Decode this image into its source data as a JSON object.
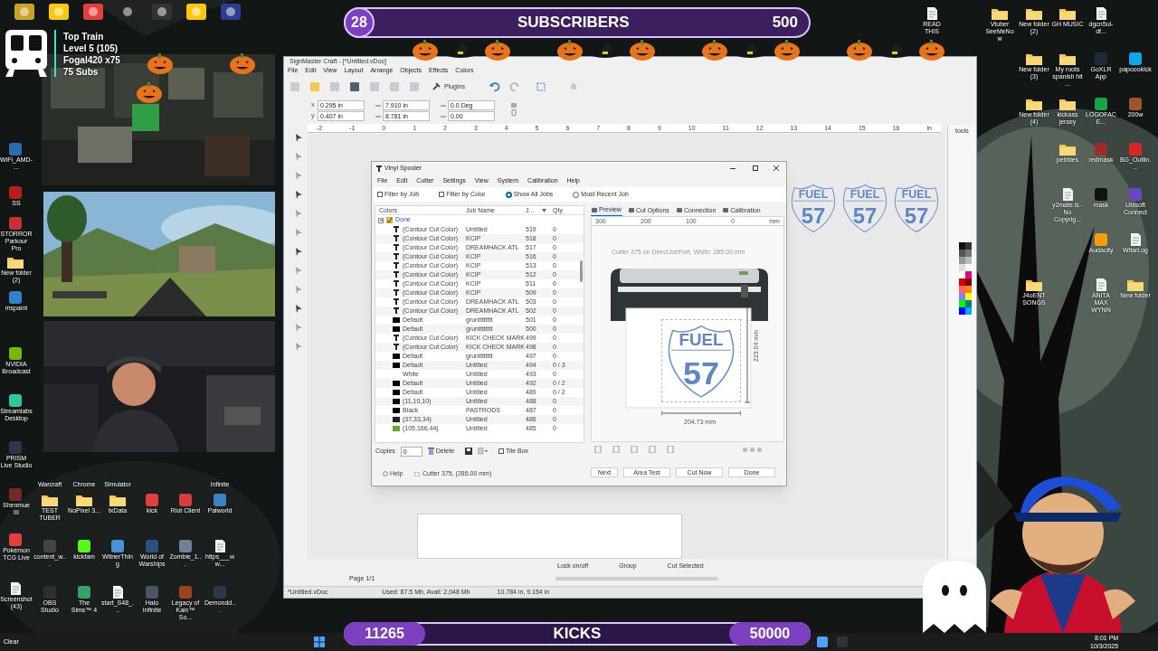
{
  "stream_overlay": {
    "subscribers": {
      "count": "28",
      "label": "SUBSCRIBERS",
      "goal": "500"
    },
    "top_train": {
      "title": "Top Train",
      "level": "Level 5  (105)",
      "leader": "Fogal420 x75",
      "subs": "75 Subs"
    },
    "kicks": {
      "count": "11265",
      "label": "KICKS",
      "goal": "50000"
    }
  },
  "desktop_left": [
    {
      "label": "WiFi_AMD-...",
      "kind": "app",
      "color": "#2b6cb0"
    },
    {
      "label": "SS",
      "kind": "app",
      "color": "#b91c1c"
    },
    {
      "label": "STORROR Parkour Pro",
      "kind": "app",
      "color": "#c53030"
    },
    {
      "label": "New folder (2)",
      "kind": "folder"
    },
    {
      "label": "mspaint",
      "kind": "app",
      "color": "#3182ce"
    },
    {
      "label": "NVIDIA Broadcast",
      "kind": "app",
      "color": "#76b900"
    },
    {
      "label": "Streamlabs Desktop",
      "kind": "app",
      "color": "#31c3a2"
    },
    {
      "label": "PRISM Live Studio",
      "kind": "app",
      "color": "#2d3748"
    },
    {
      "label": "Shenmue III",
      "kind": "app",
      "color": "#742a2a"
    },
    {
      "label": "Pokémon TCG Live",
      "kind": "app",
      "color": "#e53e3e"
    },
    {
      "label": "Screenshot (43)",
      "kind": "file"
    },
    {
      "label": "Warcraft",
      "kind": "covered"
    },
    {
      "label": "Chrome",
      "kind": "covered"
    },
    {
      "label": "Simulator",
      "kind": "covered"
    },
    {
      "label": "Infinite",
      "kind": "covered"
    },
    {
      "label": "TEST TUBER",
      "kind": "folder"
    },
    {
      "label": "NoPixel 3...",
      "kind": "folder"
    },
    {
      "label": "txData",
      "kind": "folder"
    },
    {
      "label": "kick",
      "kind": "app",
      "color": "#e53e3e"
    },
    {
      "label": "Riot Client",
      "kind": "app",
      "color": "#d53f3f"
    },
    {
      "label": "Palworld",
      "kind": "app",
      "color": "#3b82c4"
    },
    {
      "label": "content_w...",
      "kind": "app",
      "color": "#444444"
    },
    {
      "label": "kickfam",
      "kind": "app",
      "color": "#53fc18"
    },
    {
      "label": "WitnerThing",
      "kind": "app",
      "color": "#4a90d9"
    },
    {
      "label": "World of Warships",
      "kind": "app",
      "color": "#2c5282"
    },
    {
      "label": "Zombie_1...",
      "kind": "app",
      "color": "#718096"
    },
    {
      "label": "https___ww...",
      "kind": "file"
    },
    {
      "label": "OBS Studio",
      "kind": "app",
      "color": "#302e31"
    },
    {
      "label": "The Sims™ 4",
      "kind": "app",
      "color": "#38a169"
    },
    {
      "label": "start_S48_...",
      "kind": "file"
    },
    {
      "label": "Halo Infinite",
      "kind": "app",
      "color": "#4a5568"
    },
    {
      "label": "Legacy of Kain™ So...",
      "kind": "app",
      "color": "#9c4221"
    },
    {
      "label": "Demondd...",
      "kind": "app",
      "color": "#2d3748"
    }
  ],
  "desktop_right": [
    {
      "label": "READ THIS",
      "kind": "file"
    },
    {
      "label": "Vtuber SeeMeNow",
      "kind": "folder"
    },
    {
      "label": "New folder (2)",
      "kind": "folder"
    },
    {
      "label": "GH MUSIC",
      "kind": "folder"
    },
    {
      "label": "dgcn5ui-df...",
      "kind": "file"
    },
    {
      "label": "New folder (3)",
      "kind": "folder"
    },
    {
      "label": "My roots spanish hit ...",
      "kind": "folder"
    },
    {
      "label": "GoXLR App",
      "kind": "app",
      "color": "#1f2937"
    },
    {
      "label": "papoookick",
      "kind": "app",
      "color": "#0ea5e9"
    },
    {
      "label": "New folder (4)",
      "kind": "folder"
    },
    {
      "label": "kickass jersey",
      "kind": "folder"
    },
    {
      "label": "LOGOFACE...",
      "kind": "app",
      "color": "#16a34a"
    },
    {
      "label": "200w",
      "kind": "app",
      "color": "#a0522d"
    },
    {
      "label": "pebbles",
      "kind": "folder"
    },
    {
      "label": "redmask",
      "kind": "app",
      "color": "#9b2c2c"
    },
    {
      "label": "BG_Outlin...",
      "kind": "app",
      "color": "#dc2626"
    },
    {
      "label": "y2mate.is - No Copyrig...",
      "kind": "file"
    },
    {
      "label": "mask",
      "kind": "app",
      "color": "#111111"
    },
    {
      "label": "Ubisoft Connect",
      "kind": "app",
      "color": "#6b46c1"
    },
    {
      "label": "Audacity",
      "kind": "app",
      "color": "#f59e0b"
    },
    {
      "label": "WitarLog",
      "kind": "file"
    },
    {
      "label": "J4oENT SONGS",
      "kind": "folder"
    },
    {
      "label": "ANITA MAX WYNN",
      "kind": "file"
    },
    {
      "label": "New folder",
      "kind": "folder"
    }
  ],
  "signmaster": {
    "title": "SignMaster Craft - [*Untitled.vDoc]",
    "menu": [
      "File",
      "Edit",
      "View",
      "Layout",
      "Arrange",
      "Objects",
      "Effects",
      "Colors"
    ],
    "plugins": "Plugins",
    "fields": [
      {
        "label": "x",
        "value": "0.295 in"
      },
      {
        "label": "y",
        "value": "0.407 in"
      },
      {
        "value": "7.910 in"
      },
      {
        "value": "8.781 in"
      },
      {
        "value": "0.0 Deg"
      },
      {
        "value": "0.00"
      }
    ],
    "ruler": [
      "-2",
      "-1",
      "0",
      "1",
      "2",
      "3",
      "4",
      "5",
      "6",
      "7",
      "8",
      "9",
      "10",
      "11",
      "12",
      "13",
      "14",
      "15",
      "16",
      "in"
    ],
    "tools_label": "tools",
    "designs": [
      {
        "top": "FUEL",
        "number": "57"
      },
      {
        "top": "FUEL",
        "number": "57"
      },
      {
        "top": "FUEL",
        "number": "57"
      }
    ],
    "bottom_buttons": [
      "Lock on/off",
      "Group",
      "Cut Selected"
    ],
    "page": "Page 1/1",
    "status": [
      "*Untitled.vDoc",
      "Used: 87.5 Mb, Avail: 2,048 Mb",
      "10.784 in, 9.154 in"
    ]
  },
  "vinyl_spooler": {
    "title": "Vinyl Spooler",
    "menu": [
      "File",
      "Edit",
      "Cutter",
      "Settings",
      "View",
      "System",
      "Calibration",
      "Help"
    ],
    "filters": [
      {
        "kind": "checkbox",
        "label": "Filter by Job",
        "checked": false
      },
      {
        "kind": "checkbox",
        "label": "Filter by Color",
        "checked": false
      },
      {
        "kind": "radio",
        "label": "Show All Jobs",
        "selected": true
      },
      {
        "kind": "radio",
        "label": "Most Recent Job",
        "selected": false
      }
    ],
    "columns": [
      "Colors",
      "Job Name",
      "J...",
      "Qty"
    ],
    "group": {
      "label": "Done",
      "checked": true,
      "expanded": true
    },
    "rows": [
      {
        "kind": "contour",
        "color_name": "(Contour Cut Color)",
        "job": "Untitled",
        "number": "519",
        "qty": "0"
      },
      {
        "kind": "contour",
        "color_name": "(Contour Cut Color)",
        "job": "KCIP",
        "number": "518",
        "qty": "0"
      },
      {
        "kind": "contour",
        "color_name": "(Contour Cut Color)",
        "job": "DREAMHACK ATL",
        "number": "517",
        "qty": "0"
      },
      {
        "kind": "contour",
        "color_name": "(Contour Cut Color)",
        "job": "KCIP",
        "number": "516",
        "qty": "0"
      },
      {
        "kind": "contour",
        "color_name": "(Contour Cut Color)",
        "job": "KCIP",
        "number": "513",
        "qty": "0"
      },
      {
        "kind": "contour",
        "color_name": "(Contour Cut Color)",
        "job": "KCIP",
        "number": "512",
        "qty": "0"
      },
      {
        "kind": "contour",
        "color_name": "(Contour Cut Color)",
        "job": "KCIP",
        "number": "511",
        "qty": "0"
      },
      {
        "kind": "contour",
        "color_name": "(Contour Cut Color)",
        "job": "KCIP",
        "number": "509",
        "qty": "0"
      },
      {
        "kind": "contour",
        "color_name": "(Contour Cut Color)",
        "job": "DREAMHACK ATL",
        "number": "503",
        "qty": "0"
      },
      {
        "kind": "contour",
        "color_name": "(Contour Cut Color)",
        "job": "DREAMHACK ATL",
        "number": "502",
        "qty": "0"
      },
      {
        "kind": "swatch",
        "color": "#000000",
        "color_name": "Default",
        "job": "gruntttttttt",
        "number": "501",
        "qty": "0"
      },
      {
        "kind": "swatch",
        "color": "#000000",
        "color_name": "Default",
        "job": "gruntttttttt",
        "number": "500",
        "qty": "0"
      },
      {
        "kind": "contour",
        "color_name": "(Contour Cut Color)",
        "job": "KICK CHECK MARK",
        "number": "499",
        "qty": "0"
      },
      {
        "kind": "contour",
        "color_name": "(Contour Cut Color)",
        "job": "KICK CHECK MARK",
        "number": "498",
        "qty": "0"
      },
      {
        "kind": "swatch",
        "color": "#000000",
        "color_name": "Default",
        "job": "gruntttttttt",
        "number": "497",
        "qty": "0"
      },
      {
        "kind": "swatch",
        "color": "#000000",
        "color_name": "Default",
        "job": "Untitled",
        "number": "494",
        "qty": "0 / 3"
      },
      {
        "kind": "plain",
        "color_name": "White",
        "job": "Untitled",
        "number": "493",
        "qty": "0"
      },
      {
        "kind": "swatch",
        "color": "#000000",
        "color_name": "Default",
        "job": "Untitled",
        "number": "492",
        "qty": "0 / 2"
      },
      {
        "kind": "swatch",
        "color": "#000000",
        "color_name": "Default",
        "job": "Untitled",
        "number": "489",
        "qty": "0 / 2"
      },
      {
        "kind": "swatch",
        "color": "#0b0a0a",
        "color_name": "(11,10,10)",
        "job": "Untitled",
        "number": "488",
        "qty": "0"
      },
      {
        "kind": "swatch",
        "color": "#000000",
        "color_name": "Black",
        "job": "PASTRODS",
        "number": "487",
        "qty": "0"
      },
      {
        "kind": "swatch",
        "color": "#252122",
        "color_name": "(37,33,34)",
        "job": "Untitled",
        "number": "486",
        "qty": "0"
      },
      {
        "kind": "swatch",
        "color": "#69a62c",
        "color_name": "(105,166,44)",
        "job": "Untitled",
        "number": "485",
        "qty": "0"
      }
    ],
    "copies_label": "Copies",
    "copies": "0",
    "delete": "Delete",
    "tile_box": {
      "label": "Tile Box",
      "checked": false
    },
    "tabs": [
      {
        "label": "Preview",
        "selected": true
      },
      {
        "label": "Cut Options",
        "selected": false
      },
      {
        "label": "Connection",
        "selected": false
      },
      {
        "label": "Calibration",
        "selected": false
      }
    ],
    "ruler": [
      "300",
      "200",
      "100",
      "0",
      "mm"
    ],
    "info": "Cutter 375 on DirectJobPort,  Width: 285.00 mm",
    "design": {
      "top": "FUEL",
      "number": "57"
    },
    "height": "223.04 mm",
    "width": "204.73 mm",
    "help": "Help",
    "cutter": "Cutter 375,  (285.00 mm)",
    "buttons": [
      "Next",
      "Area Test",
      "Cut Now",
      "Done"
    ]
  },
  "taskbar": {
    "weather": "Clear",
    "time": "8:01 PM",
    "date": "10/3/2025"
  }
}
